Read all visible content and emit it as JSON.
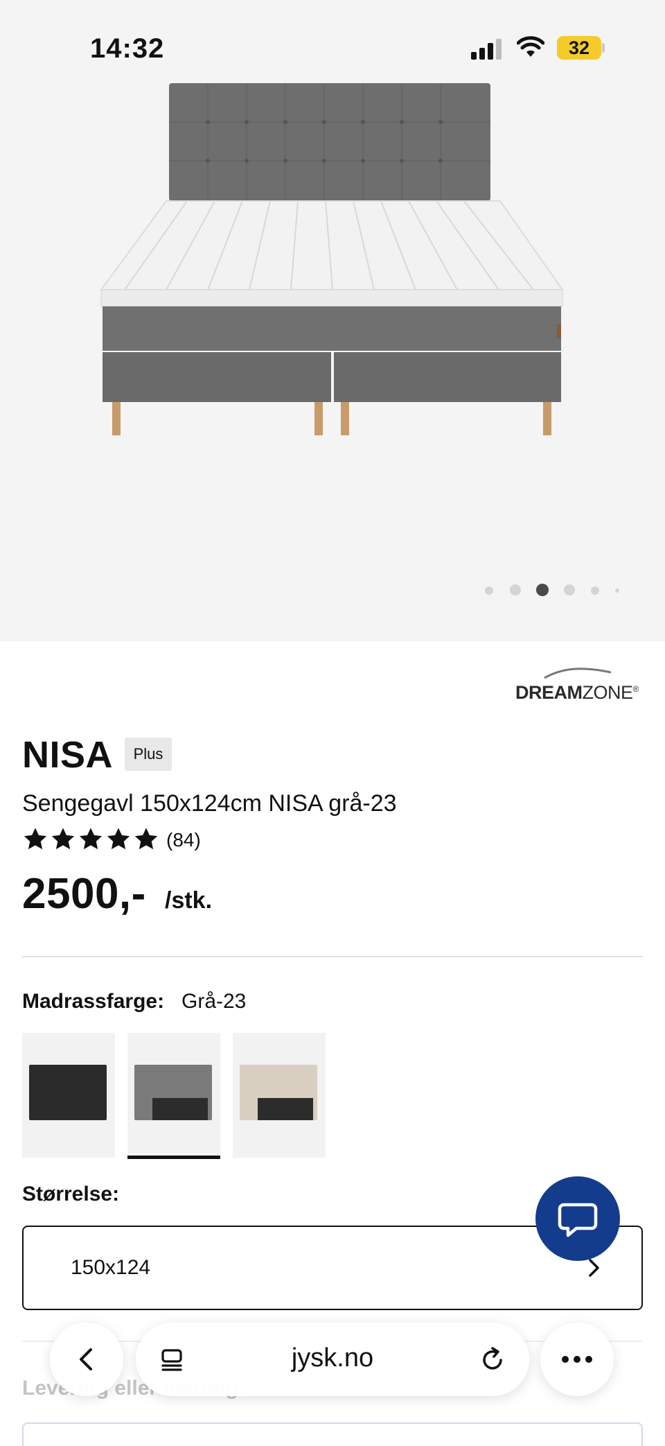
{
  "status_bar": {
    "time": "14:32",
    "battery": "32"
  },
  "carousel": {
    "total": 6,
    "active_index": 2
  },
  "brand": {
    "part1": "DREAM",
    "part2": "ZONE",
    "mark": "®"
  },
  "product": {
    "name": "NISA",
    "badge": "Plus",
    "subtitle": "Sengegavl 150x124cm NISA grå-23",
    "rating": 5,
    "review_count": "(84)",
    "price": "2500,-",
    "price_unit": "/stk."
  },
  "color_option": {
    "label": "Madrassfarge:",
    "value": "Grå-23",
    "swatches": [
      {
        "name": "svart",
        "color": "#2b2b2b"
      },
      {
        "name": "grå",
        "color": "#7a7a7a"
      },
      {
        "name": "beige",
        "color": "#d8cfc0"
      }
    ],
    "selected_index": 1
  },
  "size_option": {
    "label": "Størrelse:",
    "value": "150x124"
  },
  "delivery": {
    "label": "Levering eller henting:"
  },
  "browser": {
    "url": "jysk.no"
  },
  "colors": {
    "accent": "#143c8c",
    "battery": "#f5cb2a"
  }
}
